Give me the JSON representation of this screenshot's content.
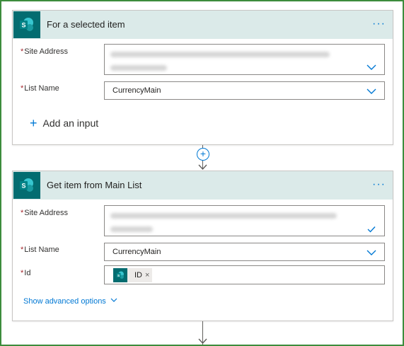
{
  "card1": {
    "title": "For a selected item",
    "more_label": "···",
    "site_address_label": "Site Address",
    "list_name_label": "List Name",
    "list_name_value": "CurrencyMain",
    "add_input_label": "Add an input",
    "add_input_icon": "+"
  },
  "connector": {
    "plus_label": "+"
  },
  "card2": {
    "title": "Get item from Main List",
    "more_label": "···",
    "site_address_label": "Site Address",
    "list_name_label": "List Name",
    "list_name_value": "CurrencyMain",
    "id_label": "Id",
    "id_token_label": "ID",
    "id_token_close": "×",
    "advanced_label": "Show advanced options"
  },
  "required_marker": "*",
  "colors": {
    "accent": "#0078d4",
    "header_bg": "#dbeae9",
    "sharepoint_brand": "#036c70",
    "required": "#a4262c",
    "frame_border": "#3c8c3c"
  },
  "icons": {
    "card_icon": "sharepoint-icon",
    "dropdown": "chevron-down-icon",
    "site_check": "checkmark-icon"
  }
}
